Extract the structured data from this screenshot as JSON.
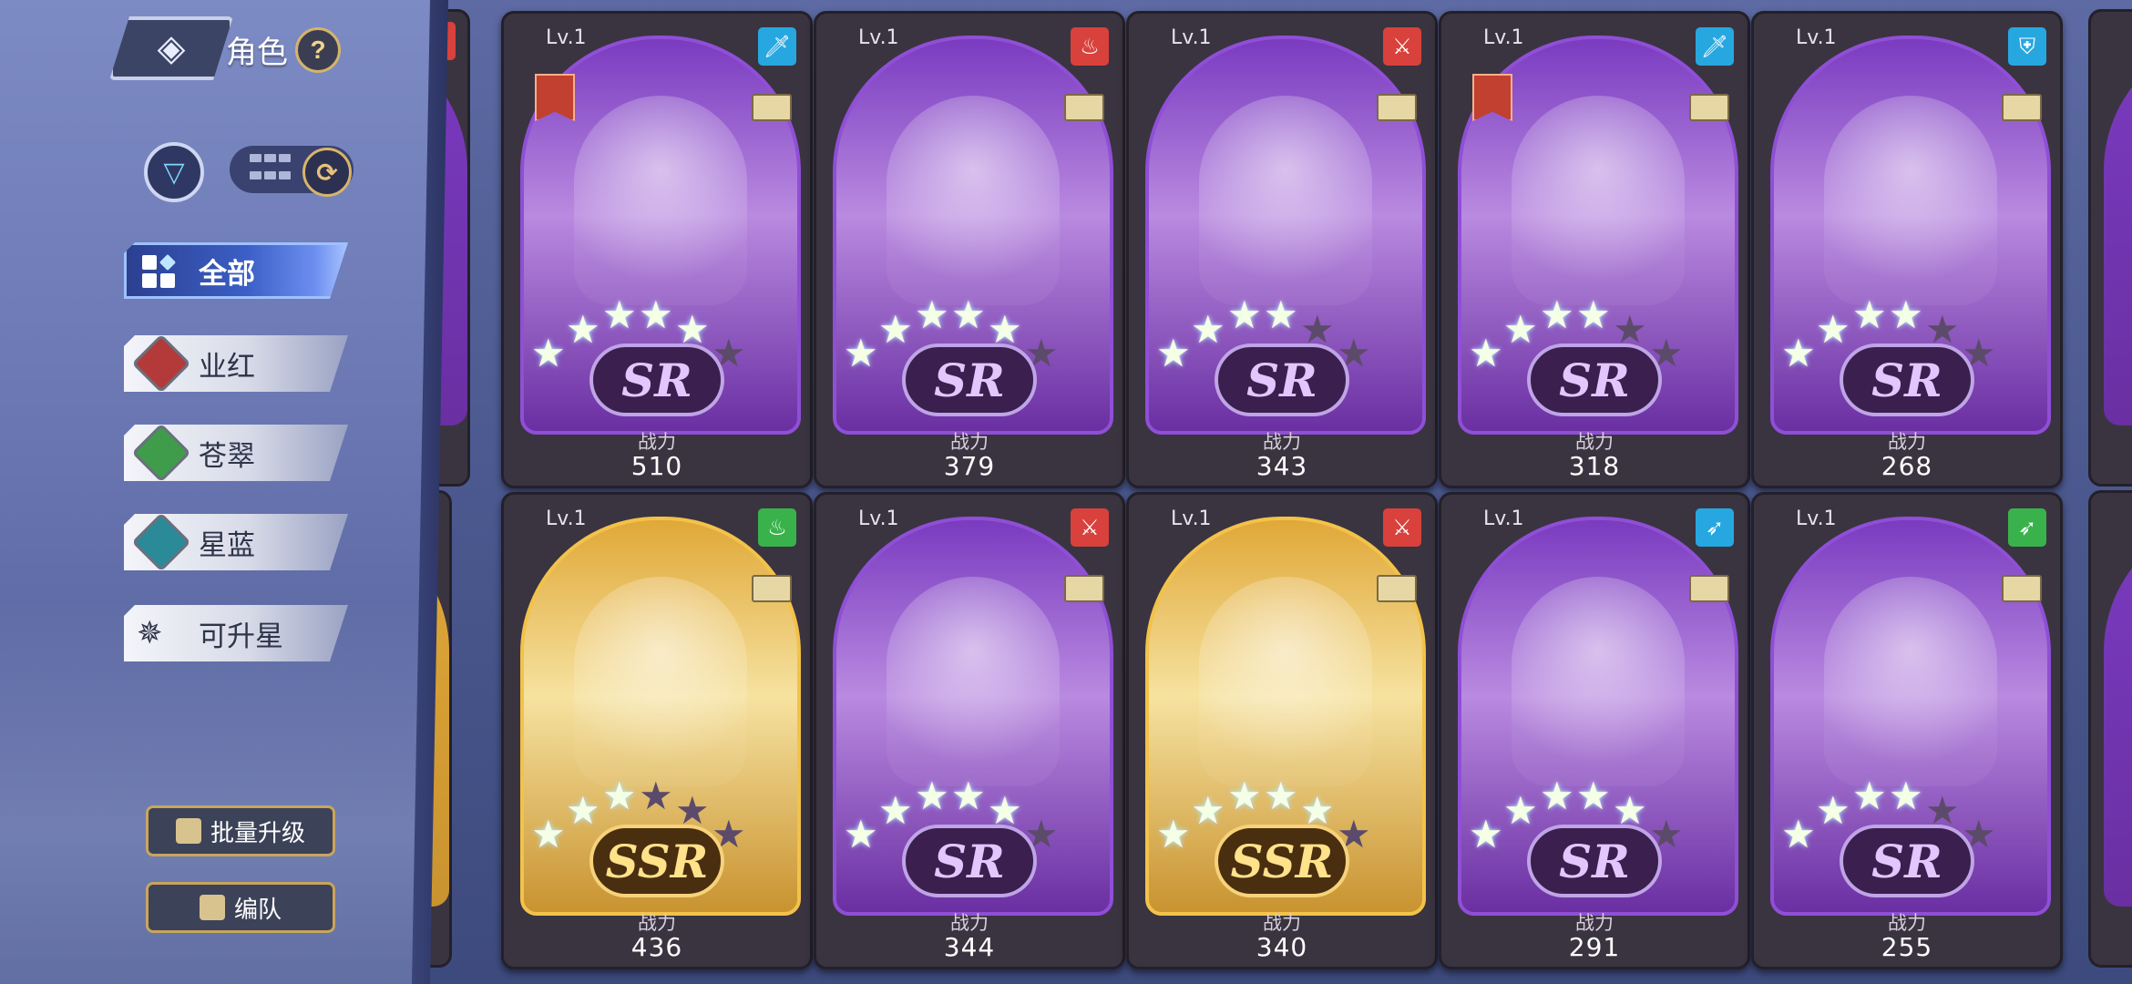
{
  "header": {
    "title": "角色",
    "back_glyph": "◈",
    "help": "?"
  },
  "toolbar": {
    "filter_glyph": "▽",
    "refresh_glyph": "⟳"
  },
  "tabs": [
    {
      "label": "全部",
      "active": true,
      "icon": "all-grid-icon"
    },
    {
      "label": "业红",
      "icon": "red-diamond-icon",
      "color": "#b43a3a"
    },
    {
      "label": "苍翠",
      "icon": "green-diamond-icon",
      "color": "#3f9c4b"
    },
    {
      "label": "星蓝",
      "icon": "blue-diamond-icon",
      "color": "#2b8a98"
    },
    {
      "label": "可升星",
      "icon": "star-upgrade-icon",
      "glyph": "✵"
    }
  ],
  "bottom_buttons": {
    "batch_upgrade": "批量升级",
    "team": "编队"
  },
  "cards": [
    {
      "lv": "Lv.1",
      "rarity": "SR",
      "cp_label": "战力",
      "cp": "510",
      "element": "blue",
      "element_glyph": "🗡",
      "stars_lit": 5
    },
    {
      "lv": "Lv.1",
      "rarity": "SR",
      "cp_label": "战力",
      "cp": "379",
      "element": "red",
      "element_glyph": "♨",
      "stars_lit": 5
    },
    {
      "lv": "Lv.1",
      "rarity": "SR",
      "cp_label": "战力",
      "cp": "343",
      "element": "red",
      "element_glyph": "⚔",
      "stars_lit": 4
    },
    {
      "lv": "Lv.1",
      "rarity": "SR",
      "cp_label": "战力",
      "cp": "318",
      "element": "blue",
      "element_glyph": "🗡",
      "stars_lit": 4
    },
    {
      "lv": "Lv.1",
      "rarity": "SR",
      "cp_label": "战力",
      "cp": "268",
      "element": "blue",
      "element_glyph": "⛨",
      "stars_lit": 4
    },
    {
      "lv": "Lv.1",
      "rarity": "SSR",
      "cp_label": "战力",
      "cp": "436",
      "element": "green",
      "element_glyph": "♨",
      "stars_lit": 3
    },
    {
      "lv": "Lv.1",
      "rarity": "SR",
      "cp_label": "战力",
      "cp": "344",
      "element": "red",
      "element_glyph": "⚔",
      "stars_lit": 5
    },
    {
      "lv": "Lv.1",
      "rarity": "SSR",
      "cp_label": "战力",
      "cp": "340",
      "element": "red",
      "element_glyph": "⚔",
      "stars_lit": 5
    },
    {
      "lv": "Lv.1",
      "rarity": "SR",
      "cp_label": "战力",
      "cp": "291",
      "element": "blue",
      "element_glyph": "➶",
      "stars_lit": 5
    },
    {
      "lv": "Lv.1",
      "rarity": "SR",
      "cp_label": "战力",
      "cp": "255",
      "element": "green",
      "element_glyph": "➶",
      "stars_lit": 4
    }
  ]
}
